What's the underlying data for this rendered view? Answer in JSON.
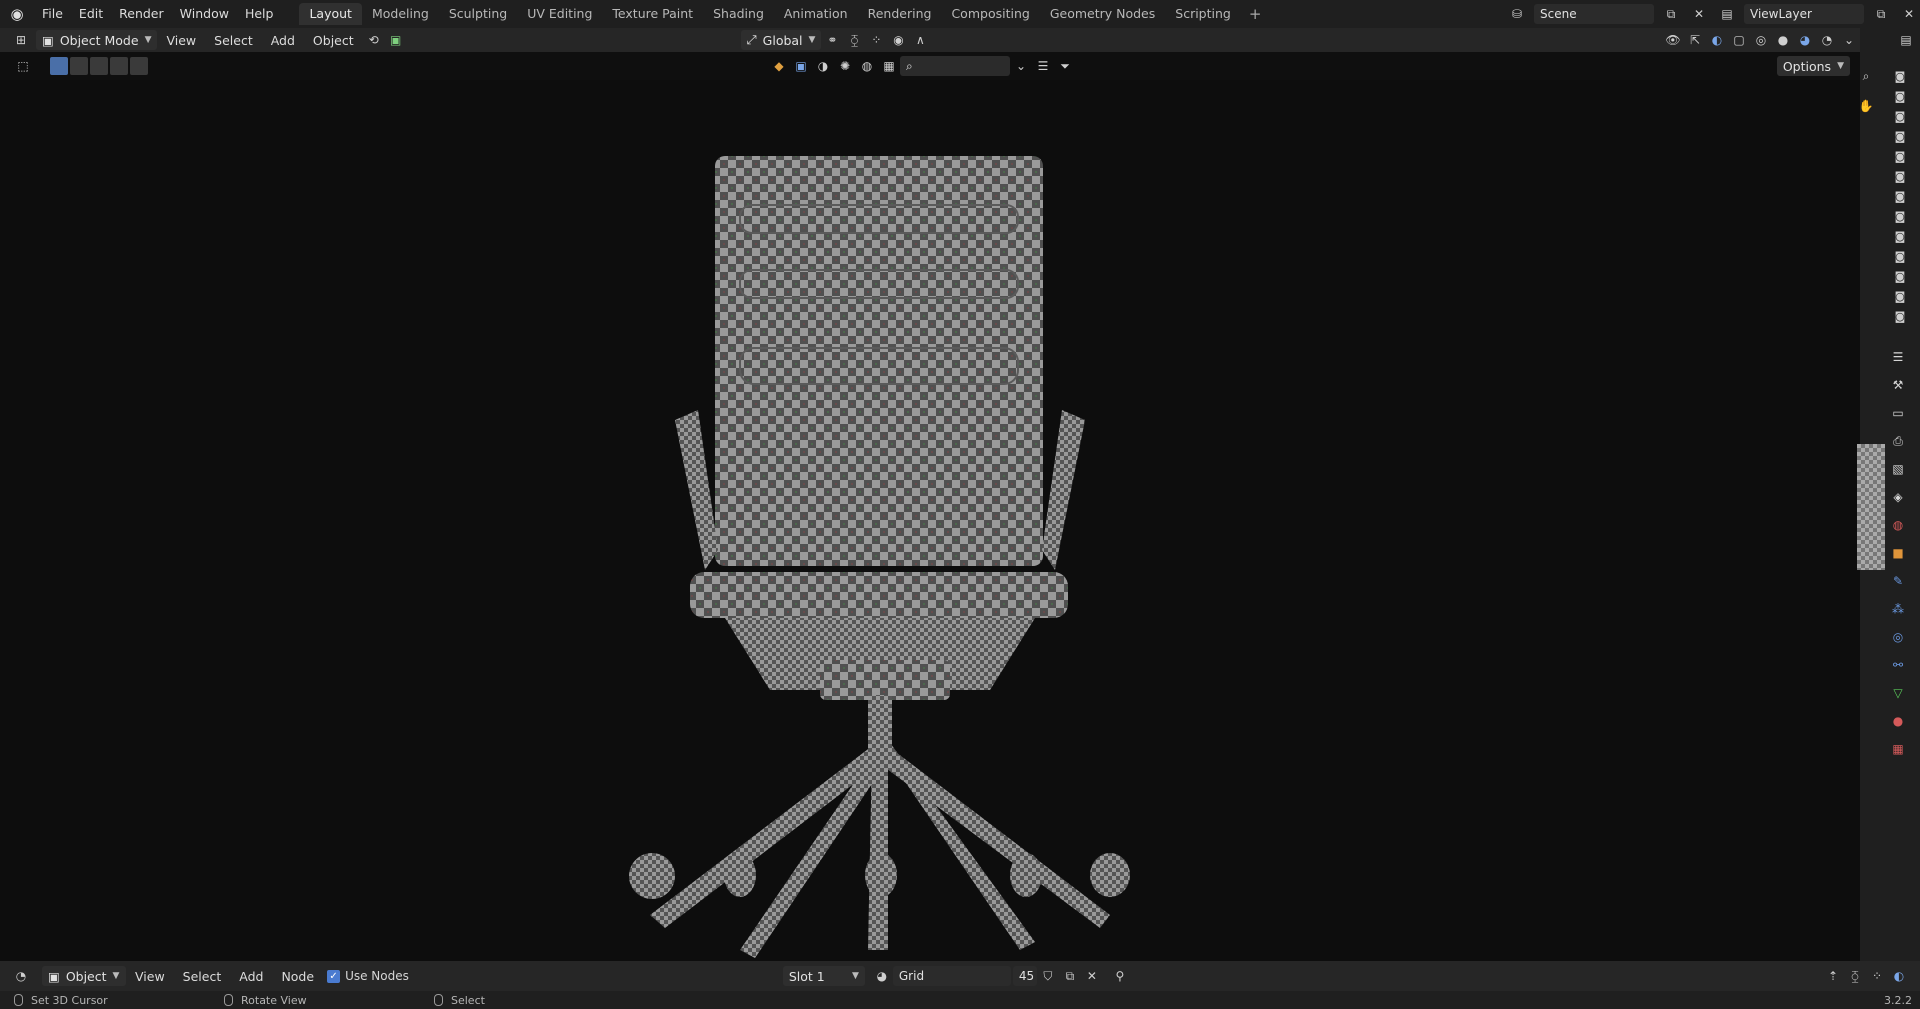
{
  "app": {
    "menu": [
      "File",
      "Edit",
      "Render",
      "Window",
      "Help"
    ],
    "workspaces": [
      "Layout",
      "Modeling",
      "Sculpting",
      "UV Editing",
      "Texture Paint",
      "Shading",
      "Animation",
      "Rendering",
      "Compositing",
      "Geometry Nodes",
      "Scripting"
    ],
    "active_workspace": "Layout",
    "add_workspace": "+",
    "scene": "Scene",
    "view_layer": "ViewLayer"
  },
  "viewport_header": {
    "mode": "Object Mode",
    "menus": [
      "View",
      "Select",
      "Add",
      "Object"
    ],
    "transform_orientation": "Global",
    "options": "Options"
  },
  "shader_editor": {
    "mode": "Object",
    "menus": [
      "View",
      "Select",
      "Add",
      "Node"
    ],
    "use_nodes_label": "Use Nodes",
    "use_nodes": true,
    "slot": "Slot 1",
    "image": "Grid",
    "users": "45"
  },
  "status": {
    "left": "Set 3D Cursor",
    "middle": "Rotate View",
    "right": "Select",
    "version": "3.2.2"
  },
  "colors": {
    "accent": "#4a7bd0",
    "background": "#0d0d0d"
  }
}
